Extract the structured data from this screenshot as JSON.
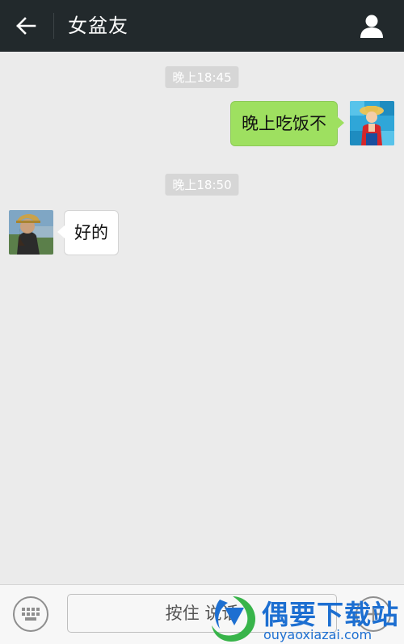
{
  "header": {
    "back_icon": "arrow-left-icon",
    "title": "女盆友",
    "profile_icon": "person-icon",
    "background": "#22292c"
  },
  "chat": {
    "background": "#ebebeb",
    "messages": [
      {
        "timestamp": "晚上18:45",
        "direction": "outgoing",
        "text": "晚上吃饭不",
        "bubble_color": "#9ee060"
      },
      {
        "timestamp": "晚上18:50",
        "direction": "incoming",
        "text": "好的",
        "bubble_color": "#ffffff"
      }
    ]
  },
  "input_bar": {
    "keyboard_icon": "keyboard-icon",
    "hold_to_talk_label": "按住 说话",
    "plus_icon": "plus-circle-icon"
  },
  "watermark": {
    "title": "偶要下载站",
    "domain": "ouyaoxiazai.com",
    "color": "#1d6fd1"
  }
}
